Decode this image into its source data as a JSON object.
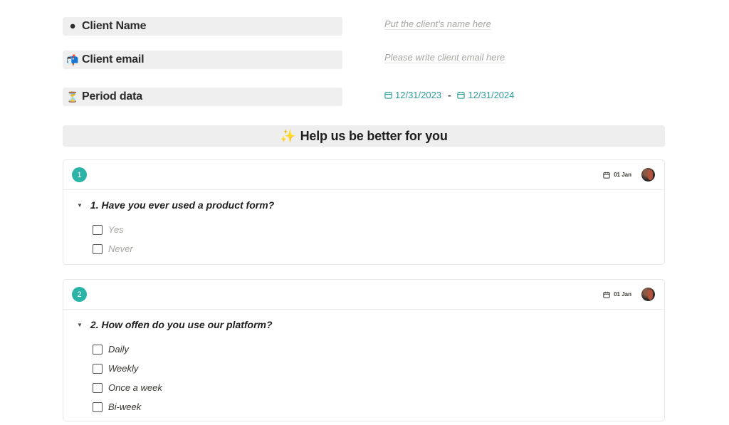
{
  "properties": {
    "client_name": {
      "icon": "⚫",
      "label": "Client Name",
      "placeholder": "Put the client's name here"
    },
    "client_email": {
      "icon": "📬",
      "label": "Client email",
      "placeholder": "Please write client email here"
    },
    "period": {
      "icon": "⏳",
      "label": "Period data",
      "start": "12/31/2023",
      "separator": "-",
      "end": "12/31/2024"
    }
  },
  "banner": {
    "icon": "✨",
    "title": "Help us be better for you"
  },
  "questions": [
    {
      "number": "1",
      "date": "01 Jan",
      "toggle": "▼",
      "question": "1. Have you ever used a product form?",
      "options": [
        "Yes",
        "Never"
      ]
    },
    {
      "number": "2",
      "date": "01 Jan",
      "toggle": "▼",
      "question": "2. How offen do you use our platform?",
      "options": [
        "Daily",
        "Weekly",
        "Once a week",
        "Bi-week"
      ]
    }
  ],
  "colors": {
    "accent": "#2ab3a6",
    "date_link": "#2a9d9a",
    "label_bg": "#efefef"
  }
}
